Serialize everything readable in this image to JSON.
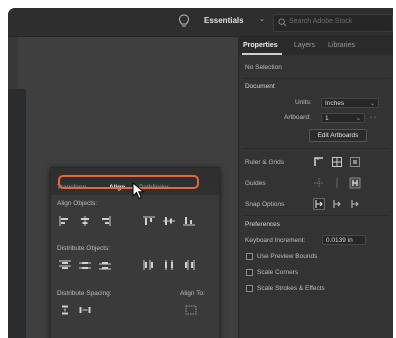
{
  "topbar": {
    "workspace": "Essentials",
    "search_placeholder": "Search Adobe Stock"
  },
  "properties_panel": {
    "tabs": [
      "Properties",
      "Layers",
      "Libraries"
    ],
    "active_tab": "Properties",
    "selection": "No Selection",
    "document_label": "Document",
    "units_label": "Units:",
    "units_value": "Inches",
    "artboard_label": "Artboard:",
    "artboard_value": "1",
    "edit_artboards": "Edit Artboards",
    "ruler_grids": "Ruler & Grids",
    "guides": "Guides",
    "snap_options": "Snap Options",
    "preferences": "Preferences",
    "keyboard_increment_label": "Keyboard Increment:",
    "keyboard_increment_value": "0.0139 in",
    "use_preview_bounds": "Use Preview Bounds",
    "scale_corners": "Scale Corners",
    "scale_strokes": "Scale Strokes & Effects"
  },
  "align_panel": {
    "tabs": [
      "Transform",
      "Align",
      "Pathfinder"
    ],
    "active_tab": "Align",
    "align_objects": "Align Objects:",
    "distribute_objects": "Distribute Objects:",
    "distribute_spacing": "Distribute Spacing:",
    "align_to": "Align To:"
  },
  "colors": {
    "highlight": "#e0693f"
  }
}
